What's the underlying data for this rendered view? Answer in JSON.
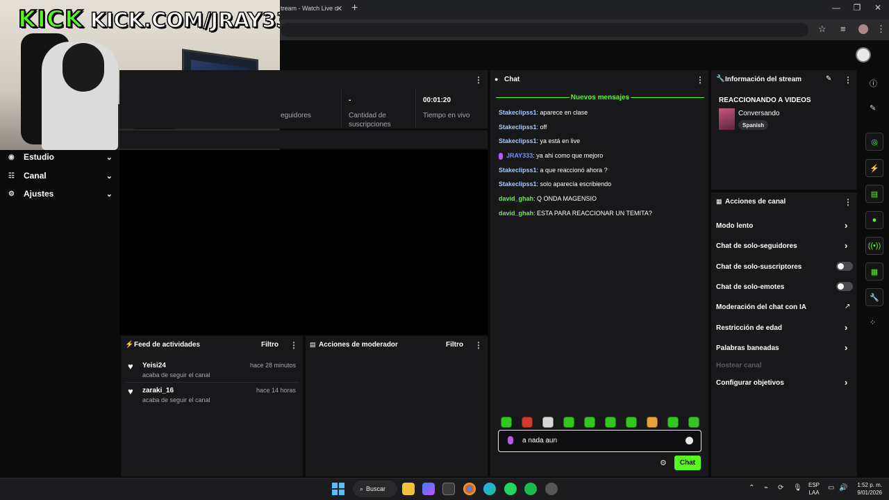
{
  "browser": {
    "tab_title": "tream - Watch Live o",
    "tab_close": "✕",
    "new_tab": "+",
    "window_controls": [
      "—",
      "❐",
      "✕"
    ]
  },
  "overlay": {
    "logo": "KICK",
    "url": "KICK.COM/JRAY333"
  },
  "sidebar": {
    "items": [
      {
        "label": "Estudio",
        "icon": "studio-icon"
      },
      {
        "label": "Canal",
        "icon": "channel-icon"
      },
      {
        "label": "Ajustes",
        "icon": "gear-icon"
      }
    ]
  },
  "stats": {
    "followers_label": "eguidores",
    "subs_value": "-",
    "subs_label_1": "Cantidad de",
    "subs_label_2": "suscripciones",
    "live_value": "00:01:20",
    "live_label": "Tiempo en vivo"
  },
  "feed": {
    "title": "Feed de actividades",
    "filter": "Filtro",
    "items": [
      {
        "user": "Yeisi24",
        "action": "acaba de seguir el canal",
        "time": "hace 28 minutos"
      },
      {
        "user": "zaraki_16",
        "action": "acaba de seguir el canal",
        "time": "hace 14 horas"
      }
    ]
  },
  "mod_actions": {
    "title": "Acciones de moderador",
    "filter": "Filtro"
  },
  "chat": {
    "title": "Chat",
    "new_messages": "Nuevos mensajes",
    "messages": [
      {
        "user": "Stakeclipss1",
        "text": ": aparece en clase",
        "color": "#a8c8ff"
      },
      {
        "user": "Stakeclipss1",
        "text": ": off",
        "color": "#a8c8ff"
      },
      {
        "user": "Stakeclipss1",
        "text": ": ya está en live",
        "color": "#a8c8ff"
      },
      {
        "user": "JRAY333",
        "text": ": ya ahi como que mejoro",
        "color": "#7b8cff"
      },
      {
        "user": "Stakeclipss1",
        "text": ": a que reaccionó ahora ?",
        "color": "#a8c8ff"
      },
      {
        "user": "Stakeclipss1",
        "text": ": solo aparecía escribiendo",
        "color": "#a8c8ff"
      },
      {
        "user": "david_ghah",
        "text": ": Q ONDA MAGENSIO",
        "color": "#7ee05a"
      },
      {
        "user": "david_ghah",
        "text": ": ESTA PARA REACCIONAR UN TEMITA?",
        "color": "#7ee05a"
      }
    ],
    "input_value": "a nada aun",
    "send_label": "Chat"
  },
  "stream_info": {
    "title": "Información del stream",
    "stream_title": "REACCIONANDO A VIDEOS",
    "category": "Conversando",
    "language": "Spanish"
  },
  "channel_actions": {
    "title": "Acciones de canal",
    "items": [
      {
        "label": "Modo lento",
        "control": "chevron"
      },
      {
        "label": "Chat de solo-seguidores",
        "control": "chevron"
      },
      {
        "label": "Chat de solo-suscriptores",
        "control": "toggle"
      },
      {
        "label": "Chat de solo-emotes",
        "control": "toggle"
      },
      {
        "label": "Moderación del chat con IA",
        "control": "external"
      },
      {
        "label": "Restricción de edad",
        "control": "chevron"
      },
      {
        "label": "Palabras baneadas",
        "control": "chevron"
      },
      {
        "label": "Hostear canal",
        "control": "none"
      },
      {
        "label": "Configurar objetivos",
        "control": "chevron"
      }
    ]
  },
  "taskbar": {
    "search": "Buscar",
    "lang_1": "ESP",
    "lang_2": "LAA",
    "time": "1:52 p. m.",
    "date": "9/01/2026"
  },
  "colors": {
    "accent": "#53fc18",
    "panel": "#18181b",
    "background": "#0b0b0c"
  }
}
